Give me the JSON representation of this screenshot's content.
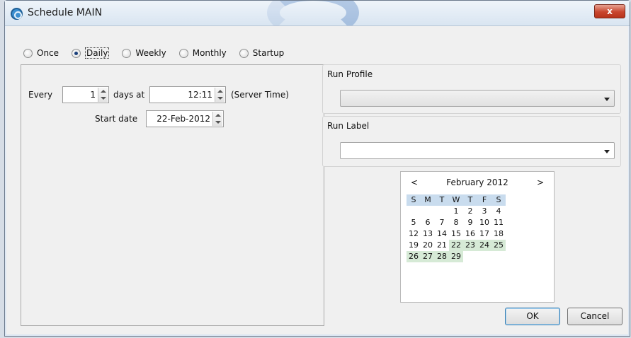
{
  "window": {
    "title": "Schedule MAIN",
    "close_label": "x"
  },
  "schedule_types": [
    {
      "label": "Once",
      "checked": false
    },
    {
      "label": "Daily",
      "checked": true
    },
    {
      "label": "Weekly",
      "checked": false
    },
    {
      "label": "Monthly",
      "checked": false
    },
    {
      "label": "Startup",
      "checked": false
    }
  ],
  "daily": {
    "every_label": "Every",
    "every_value": "1",
    "days_at_label": "days at",
    "time_value": "12:11",
    "server_time_label": "(Server Time)",
    "start_date_label": "Start date",
    "start_date_value": "22-Feb-2012"
  },
  "run_profile": {
    "label": "Run Profile",
    "value": "",
    "enabled": false
  },
  "run_label": {
    "label": "Run Label",
    "value": "",
    "enabled": true
  },
  "calendar": {
    "prev": "<",
    "next": ">",
    "month_title": "February 2012",
    "weekdays": [
      "S",
      "M",
      "T",
      "W",
      "T",
      "F",
      "S"
    ],
    "first_weekday_index": 3,
    "days_in_month": 29,
    "highlighted_days": [
      22,
      23,
      24,
      25,
      26,
      27,
      28,
      29
    ]
  },
  "buttons": {
    "ok": "OK",
    "cancel": "Cancel"
  }
}
